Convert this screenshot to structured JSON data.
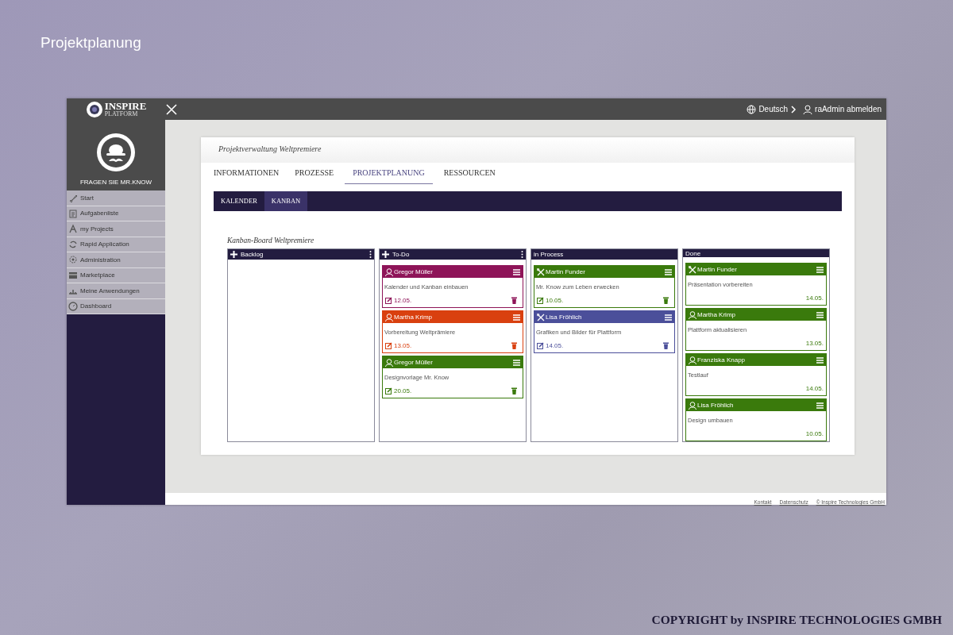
{
  "slide_title": "Projektplanung",
  "app": {
    "logo": {
      "name": "INSPIRE",
      "sub": "PLATFORM"
    },
    "topbar": {
      "language": "Deutsch",
      "user": "raAdmin abmelden"
    },
    "assistant": {
      "label": "FRAGEN SIE MR.KNOW"
    },
    "sidebar": {
      "items": [
        {
          "label": "Start",
          "selected": false
        },
        {
          "label": "Aufgabenliste",
          "selected": false
        },
        {
          "label": "my Projects",
          "selected": false
        },
        {
          "label": "Rapid Application",
          "selected": false
        },
        {
          "label": "Administration",
          "selected": false
        },
        {
          "label": "Marketplace",
          "selected": false
        },
        {
          "label": "Meine Anwendungen",
          "selected": false
        },
        {
          "label": "Dashboard",
          "selected": false
        }
      ]
    },
    "page_title": "Projektverwaltung Weltpremiere",
    "tabs": [
      {
        "label": "INFORMATIONEN",
        "selected": false
      },
      {
        "label": "PROZESSE",
        "selected": false
      },
      {
        "label": "PROJEKTPLANUNG",
        "selected": true
      },
      {
        "label": "RESSOURCEN",
        "selected": false
      }
    ],
    "subtabs": [
      {
        "label": "KALENDER",
        "selected": false
      },
      {
        "label": "KANBAN",
        "selected": true
      }
    ],
    "board": {
      "title": "Kanban-Board Weltpremiere",
      "columns": [
        {
          "title": "Backlog",
          "addable": true
        },
        {
          "title": "To-Do",
          "addable": true,
          "cards": [
            {
              "kind": "task",
              "assignee": "Gregor Müller",
              "task": "Kalender und Kanban einbauen",
              "date": "12.05.",
              "color": "#8e1458"
            },
            {
              "kind": "task",
              "assignee": "Martha Krimp",
              "task": "Vorbereitung Weltprämiere",
              "date": "13.05.",
              "color": "#d9400f"
            },
            {
              "kind": "task",
              "assignee": "Gregor Müller",
              "task": "Designvorlage Mr. Know",
              "date": "20.05.",
              "color": "#3a7a0c"
            }
          ]
        },
        {
          "title": "in Process",
          "addable": false,
          "cards": [
            {
              "kind": "worktask",
              "assignee": "Martin Funder",
              "task": "Mr. Know zum Leben erwecken",
              "date": "10.05.",
              "color": "#3a7a0c"
            },
            {
              "kind": "worktask",
              "assignee": "Lisa Fröhlich",
              "task": "Grafiken und Bilder für Plattform",
              "date": "14.05.",
              "color": "#4b4f9a"
            }
          ]
        },
        {
          "title": "Done",
          "addable": false,
          "cards": [
            {
              "kind": "workdone",
              "assignee": "Martin Funder",
              "task": "Präsentation vorbereiten",
              "date": "14.05.",
              "color": "#3a7a0c"
            },
            {
              "kind": "done",
              "assignee": "Martha Krimp",
              "task": "Plattform aktualisieren",
              "date": "13.05.",
              "color": "#3a7a0c"
            },
            {
              "kind": "done",
              "assignee": "Franziska Knapp",
              "task": "Testlauf",
              "date": "14.05.",
              "color": "#3a7a0c"
            },
            {
              "kind": "done",
              "assignee": "Lisa Fröhlich",
              "task": "Design umbauen",
              "date": "10.05.",
              "color": "#3a7a0c"
            }
          ]
        }
      ]
    },
    "footer_links": [
      "Kontakt",
      "Datenschutz",
      "© Inspire Technologies GmbH"
    ]
  },
  "copyright": "COPYRIGHT by INSPIRE TECHNOLOGIES GMBH"
}
